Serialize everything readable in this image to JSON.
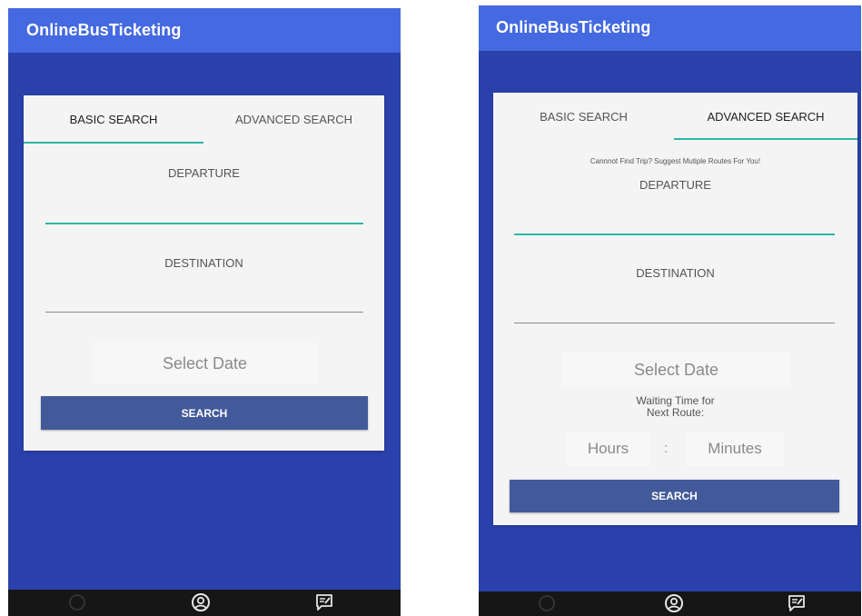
{
  "app": {
    "title": "OnlineBusTicketing"
  },
  "basic_screen": {
    "tabs": [
      {
        "label": "BASIC SEARCH",
        "active": true
      },
      {
        "label": "ADVANCED SEARCH",
        "active": false
      }
    ],
    "departure_label": "DEPARTURE",
    "destination_label": "DESTINATION",
    "date_placeholder": "Select Date",
    "search_label": "SEARCH"
  },
  "advanced_screen": {
    "tabs": [
      {
        "label": "BASIC SEARCH",
        "active": false
      },
      {
        "label": "ADVANCED SEARCH",
        "active": true
      }
    ],
    "hint": "Cannnot Find Trip? Suggest Mutiple Routes For You!",
    "departure_label": "DEPARTURE",
    "destination_label": "DESTINATION",
    "date_placeholder": "Select Date",
    "waiting_label_line1": "Waiting Time for",
    "waiting_label_line2": "Next Route:",
    "hours_placeholder": "Hours",
    "time_separator": ":",
    "minutes_placeholder": "Minutes",
    "search_label": "SEARCH"
  },
  "navbar": {
    "icons": [
      "home-icon",
      "profile-icon",
      "feedback-icon"
    ]
  },
  "colors": {
    "app_bar": "#4469e0",
    "background": "#2a41ab",
    "accent": "#2fb5a3",
    "button": "#435a9a"
  }
}
